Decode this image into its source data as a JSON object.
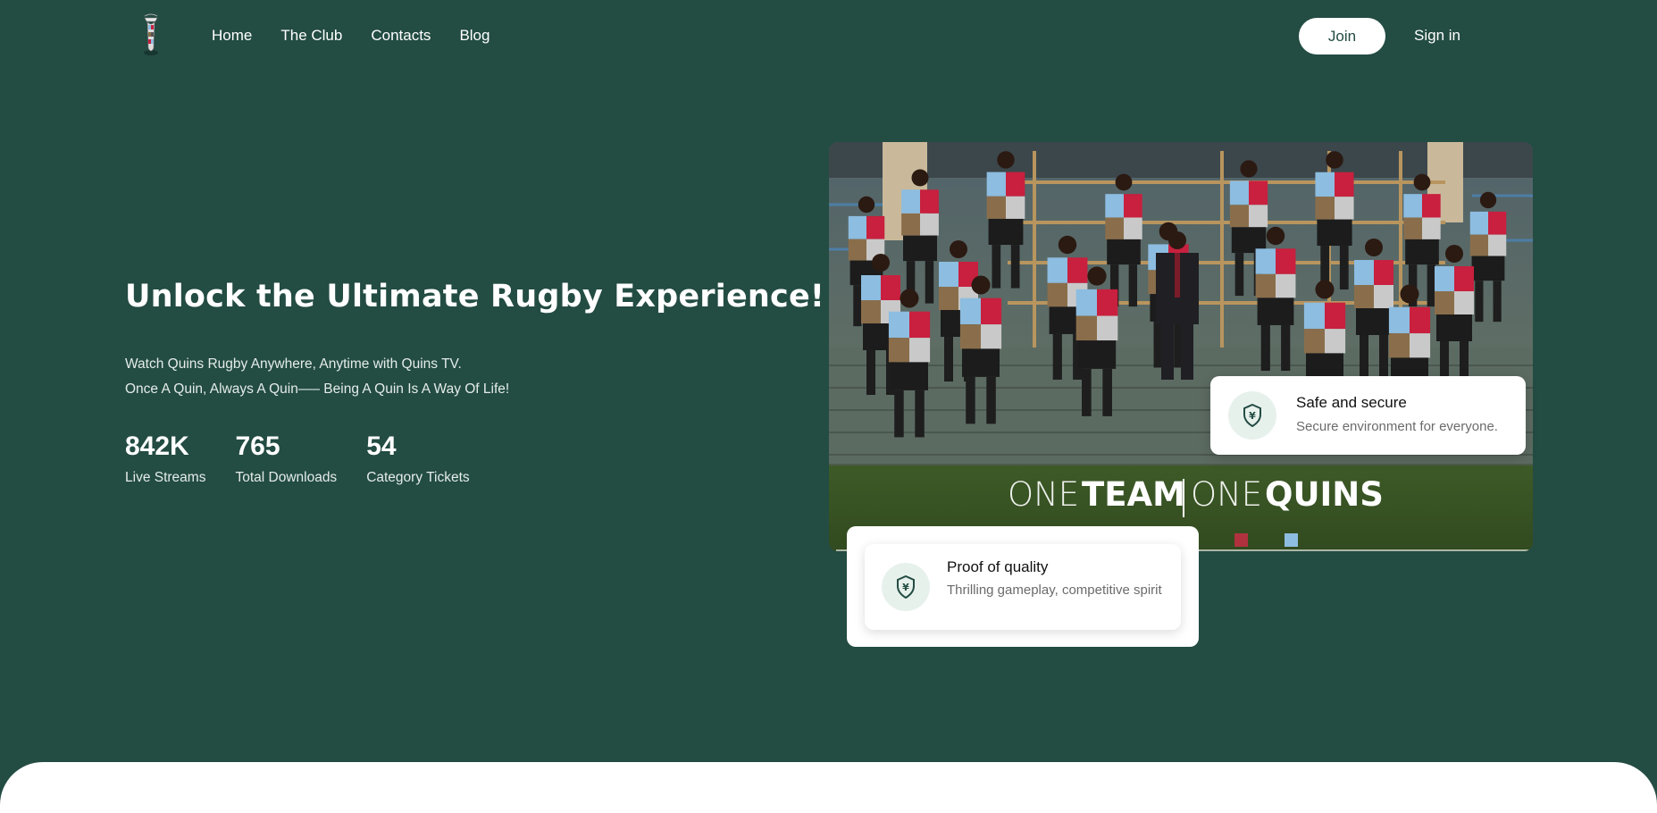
{
  "nav": {
    "logo": "harlequin-mascot-logo",
    "links": [
      "Home",
      "The Club",
      "Contacts",
      "Blog"
    ],
    "join_label": "Join",
    "signin_label": "Sign in"
  },
  "hero": {
    "title": "Unlock the Ultimate Rugby Experience!",
    "subtitle_line1": "Watch Quins Rugby Anywhere, Anytime with Quins TV.",
    "subtitle_line2": "Once A Quin, Always A Quin—– Being A Quin Is A Way Of Life!",
    "stats": [
      {
        "value": "842K",
        "label": "Live Streams"
      },
      {
        "value": "765",
        "label": "Total Downloads"
      },
      {
        "value": "54",
        "label": "Category Tickets"
      }
    ]
  },
  "photo": {
    "banner_one1": "ONE ",
    "banner_team": "TEAM",
    "banner_one2": "ONE ",
    "banner_quins": "QUINS"
  },
  "cards": {
    "safe": {
      "title": "Safe and secure",
      "desc": "Secure environment for everyone.",
      "icon": "shield-yen-icon"
    },
    "quality": {
      "title": "Proof of quality",
      "desc": "Thrilling gameplay, competitive spirit",
      "icon": "shield-yen-icon"
    }
  },
  "colors": {
    "background": "#234c43",
    "kit_blue": "#8dbde0",
    "kit_red": "#c8203e",
    "kit_brown": "#8a6e4b",
    "kit_grey": "#c9c9c9"
  }
}
